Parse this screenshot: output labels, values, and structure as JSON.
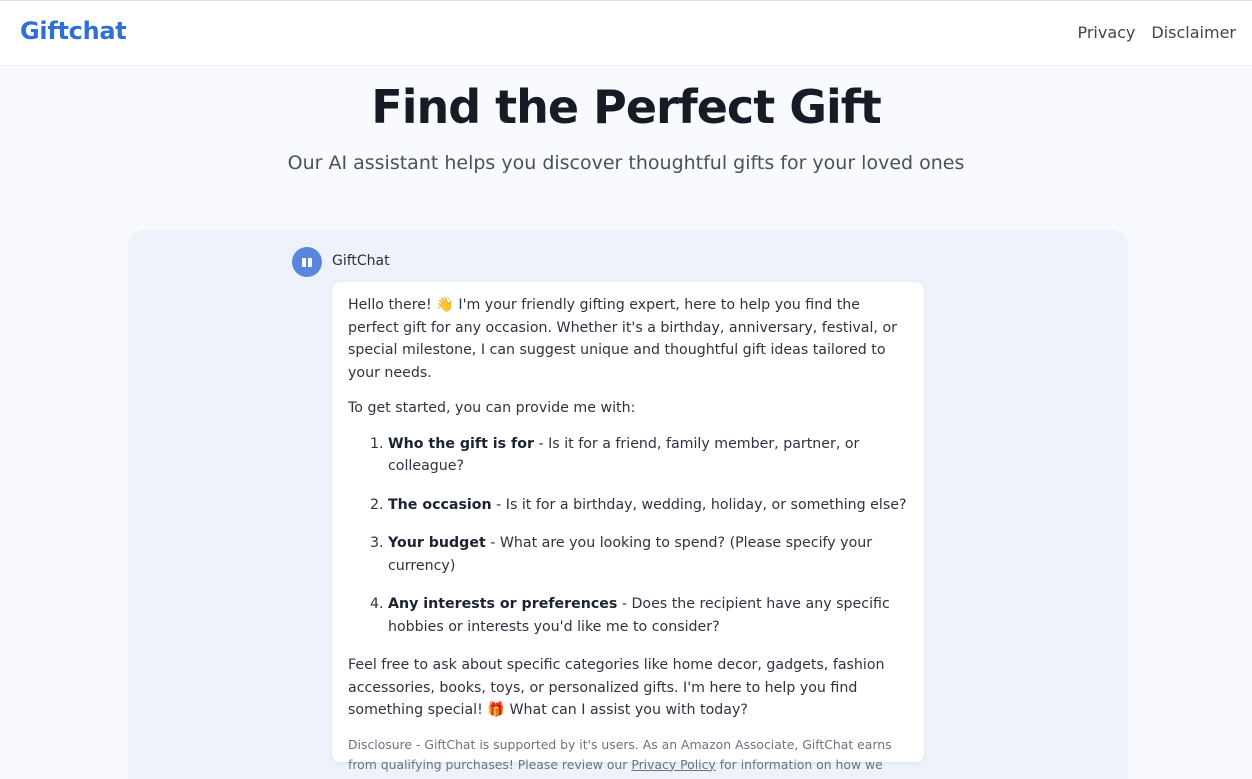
{
  "header": {
    "brand": "Giftchat",
    "nav": [
      {
        "label": "Privacy"
      },
      {
        "label": "Disclaimer"
      }
    ]
  },
  "hero": {
    "title": "Find the Perfect Gift",
    "subtitle": "Our AI assistant helps you discover thoughtful gifts for your loved ones"
  },
  "chat": {
    "bot_name": "GiftChat",
    "message": {
      "intro_before_emoji": "Hello there! ",
      "intro_emoji": "👋",
      "intro_after_emoji": " I'm your friendly gifting expert, here to help you find the perfect gift for any occasion. Whether it's a birthday, anniversary, festival, or special milestone, I can suggest unique and thoughtful gift ideas tailored to your needs.",
      "prompt": "To get started, you can provide me with:",
      "items": [
        {
          "num": "1.",
          "title": "Who the gift is for",
          "text": " - Is it for a friend, family member, partner, or colleague?"
        },
        {
          "num": "2.",
          "title": "The occasion",
          "text": " - Is it for a birthday, wedding, holiday, or something else?"
        },
        {
          "num": "3.",
          "title": "Your budget",
          "text": " - What are you looking to spend? (Please specify your currency)"
        },
        {
          "num": "4.",
          "title": "Any interests or preferences",
          "text": " - Does the recipient have any specific hobbies or interests you'd like me to consider?"
        }
      ],
      "closing_before_emoji": "Feel free to ask about specific categories like home decor, gadgets, fashion accessories, books, toys, or personalized gifts. I'm here to help you find something special! ",
      "closing_emoji": "🎁",
      "closing_after_emoji": " What can I assist you with today?",
      "disclosure_before_link": "Disclosure - GiftChat is supported by it's users. As an Amazon Associate, GiftChat earns from qualifying purchases! Please review our ",
      "disclosure_link": "Privacy Policy",
      "disclosure_after_link": " for information on how we handle user data."
    }
  },
  "colors": {
    "brand": "#2f6fd6",
    "avatar": "#5b86dd",
    "panel": "#eef2fa",
    "background": "#f8fafd"
  },
  "icons": {
    "avatar": "gift-icon"
  }
}
